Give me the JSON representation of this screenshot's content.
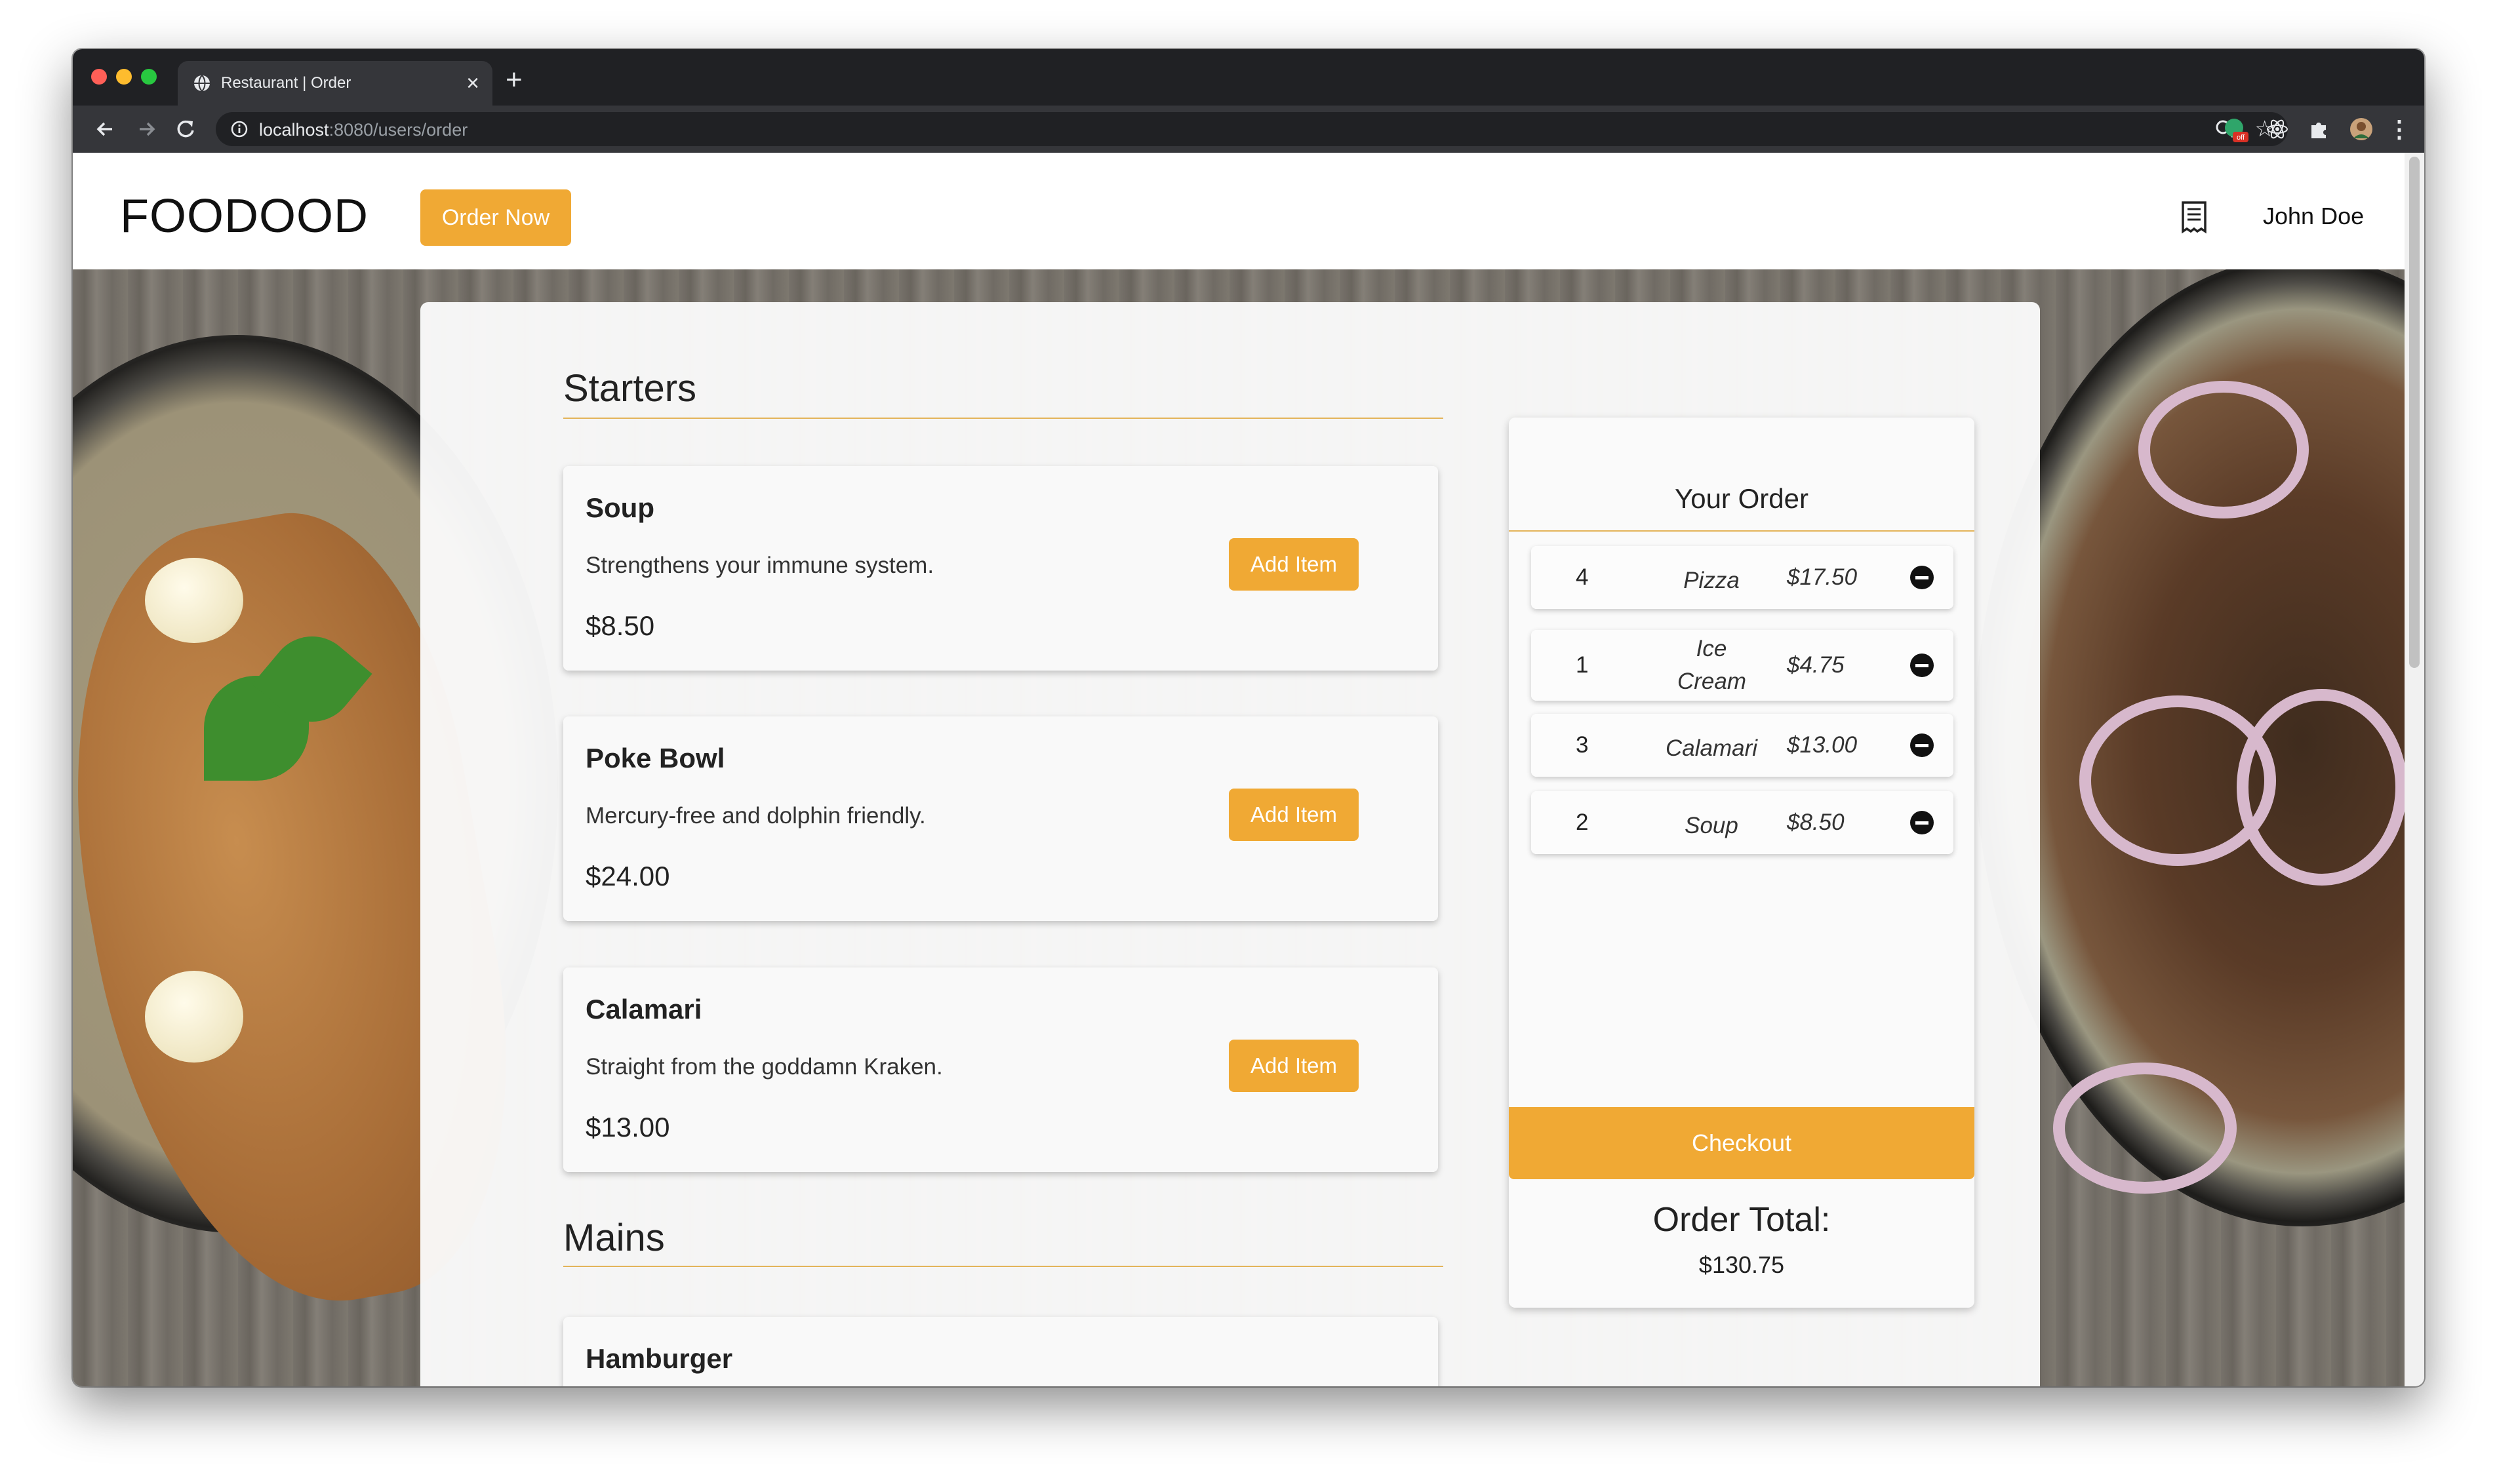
{
  "browser": {
    "tab_title": "Restaurant | Order",
    "url_host": "localhost",
    "url_path": ":8080/users/order",
    "extension_badge": "off"
  },
  "header": {
    "brand": "FOODOOD",
    "order_now": "Order Now",
    "user_name": "John Doe"
  },
  "menu": {
    "starters": {
      "title": "Starters",
      "items": [
        {
          "name": "Soup",
          "description": "Strengthens your immune system.",
          "price": "$8.50",
          "button": "Add Item"
        },
        {
          "name": "Poke Bowl",
          "description": "Mercury-free and dolphin friendly.",
          "price": "$24.00",
          "button": "Add Item"
        },
        {
          "name": "Calamari",
          "description": "Straight from the goddamn Kraken.",
          "price": "$13.00",
          "button": "Add Item"
        }
      ]
    },
    "mains": {
      "title": "Mains",
      "items": [
        {
          "name": "Hamburger"
        }
      ]
    }
  },
  "order": {
    "title": "Your Order",
    "items": [
      {
        "qty": "4",
        "name": "Pizza",
        "price": "$17.50"
      },
      {
        "qty": "1",
        "name": "Ice Cream",
        "price": "$4.75"
      },
      {
        "qty": "3",
        "name": "Calamari",
        "price": "$13.00"
      },
      {
        "qty": "2",
        "name": "Soup",
        "price": "$8.50"
      }
    ],
    "checkout": "Checkout",
    "total_label": "Order Total:",
    "total_value": "$130.75"
  },
  "colors": {
    "accent": "#f0a934",
    "tab_strip": "#202124",
    "toolbar": "#35363a"
  }
}
